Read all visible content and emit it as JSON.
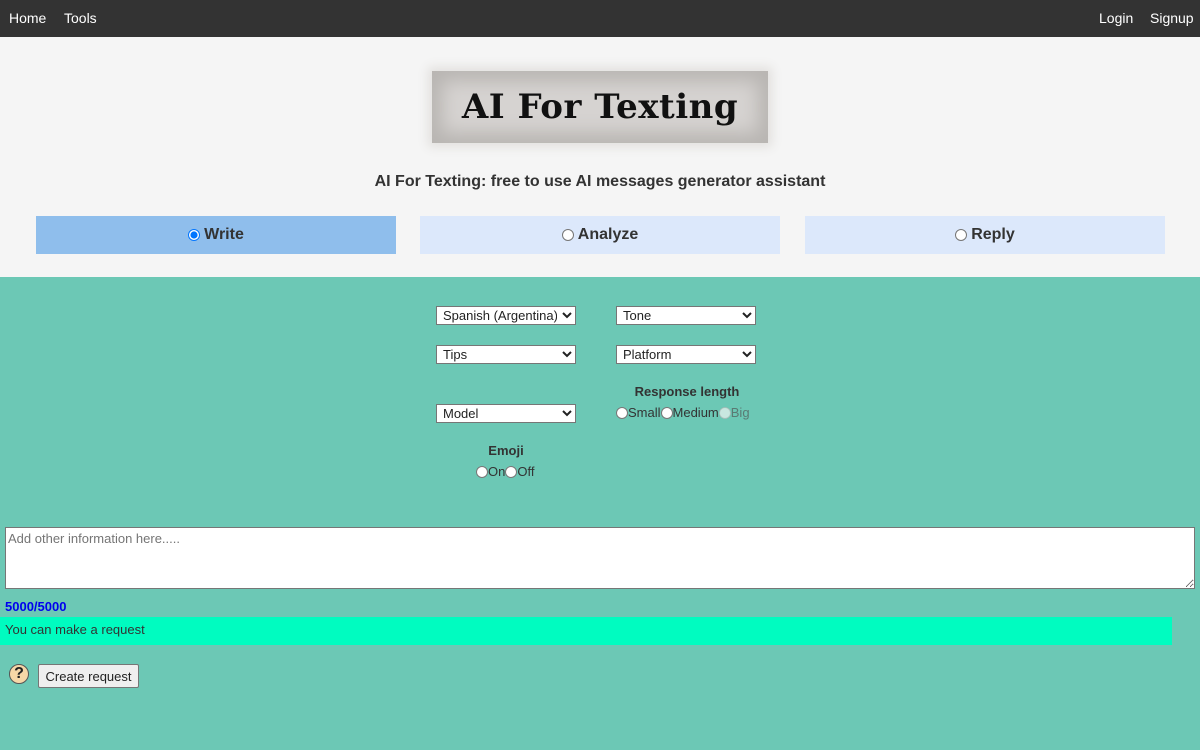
{
  "nav": {
    "home": "Home",
    "tools": "Tools",
    "login": "Login",
    "signup": "Signup"
  },
  "header": {
    "logo_text": "AI For Texting",
    "subtitle": "AI For Texting: free to use AI messages generator assistant"
  },
  "modes": {
    "selected": "Write",
    "write": "Write",
    "analyze": "Analyze",
    "reply": "Reply"
  },
  "options": {
    "language": "Spanish (Argentina) - es",
    "tone": "Tone",
    "tips": "Tips",
    "platform": "Platform",
    "model": "Model",
    "response_length": {
      "title": "Response length",
      "small": "Small",
      "medium": "Medium",
      "big": "Big"
    },
    "emoji": {
      "title": "Emoji",
      "on": "On",
      "off": "Off"
    }
  },
  "input": {
    "placeholder": "Add other information here.....",
    "counter": "5000/5000"
  },
  "status": {
    "message": "You can make a request"
  },
  "actions": {
    "help_symbol": "?",
    "create_request": "Create request"
  }
}
